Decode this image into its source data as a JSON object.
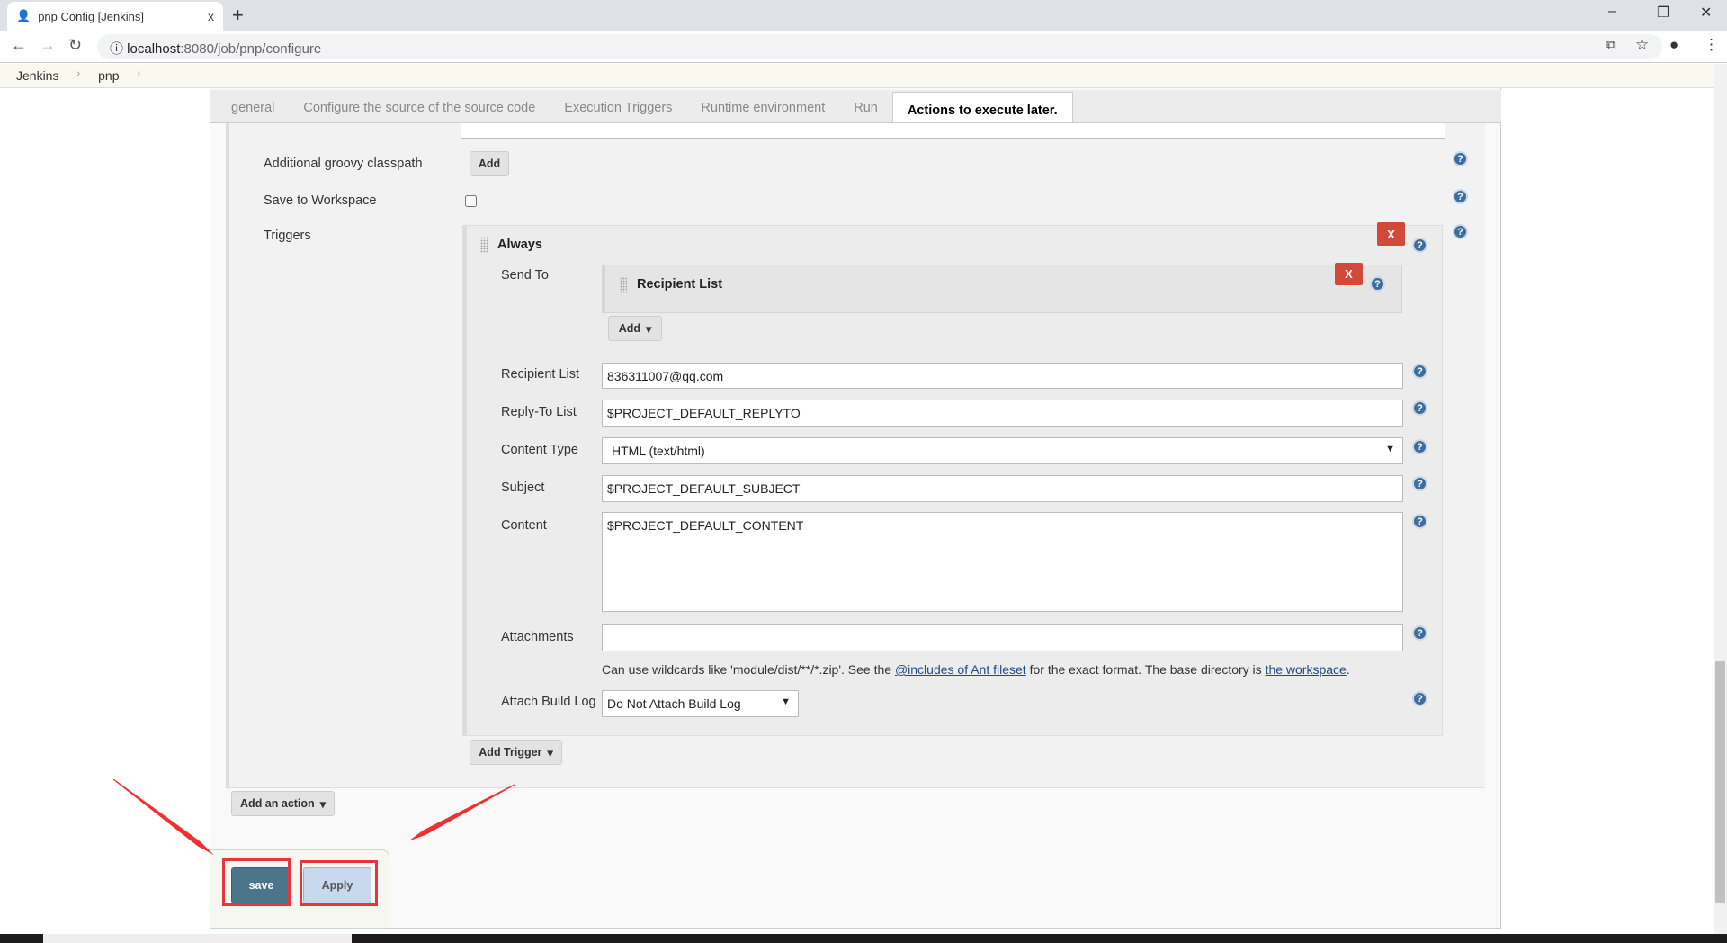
{
  "browser": {
    "tab_title": "pnp Config [Jenkins]",
    "tab_close": "x",
    "new_tab": "+",
    "url_host": "localhost",
    "url_path": ":8080/job/pnp/configure"
  },
  "breadcrumb": [
    "Jenkins",
    "pnp"
  ],
  "config_tabs": [
    {
      "label": "general"
    },
    {
      "label": "Configure the source of the source code"
    },
    {
      "label": "Execution Triggers"
    },
    {
      "label": "Runtime environment"
    },
    {
      "label": "Run"
    },
    {
      "label": "Actions to execute later.",
      "active": true
    }
  ],
  "form": {
    "groovy_classpath_label": "Additional groovy classpath",
    "add_label": "Add",
    "save_workspace_label": "Save to Workspace",
    "save_workspace_checked": false,
    "triggers_label": "Triggers",
    "trigger": {
      "name": "Always",
      "delete_label": "X",
      "send_to_label": "Send To",
      "recipient_block": "Recipient List",
      "add_label": "Add",
      "recipient_list_label": "Recipient List",
      "recipient_list": "836311007@qq.com",
      "reply_to_label": "Reply-To List",
      "reply_to": "$PROJECT_DEFAULT_REPLYTO",
      "content_type_label": "Content Type",
      "content_type": "HTML (text/html)",
      "subject_label": "Subject",
      "subject": "$PROJECT_DEFAULT_SUBJECT",
      "content_label": "Content",
      "content": "$PROJECT_DEFAULT_CONTENT",
      "attachments_label": "Attachments",
      "attachments": "",
      "hint_1": "Can use wildcards like 'module/dist/**/*.zip'. See the ",
      "hint_link1": "@includes of Ant fileset",
      "hint_2": " for the exact format. The base directory is ",
      "hint_link2": "the workspace",
      "hint_3": ".",
      "build_log_label": "Attach Build Log",
      "build_log": "Do Not Attach Build Log"
    },
    "add_trigger": "Add Trigger",
    "add_action": "Add an action"
  },
  "footer": {
    "save": "save",
    "apply": "Apply"
  },
  "colors": {
    "save_bg": "#4b758b",
    "apply_bg": "#c8d9ee",
    "delete": "#d24939",
    "annotation": "#f03030"
  }
}
